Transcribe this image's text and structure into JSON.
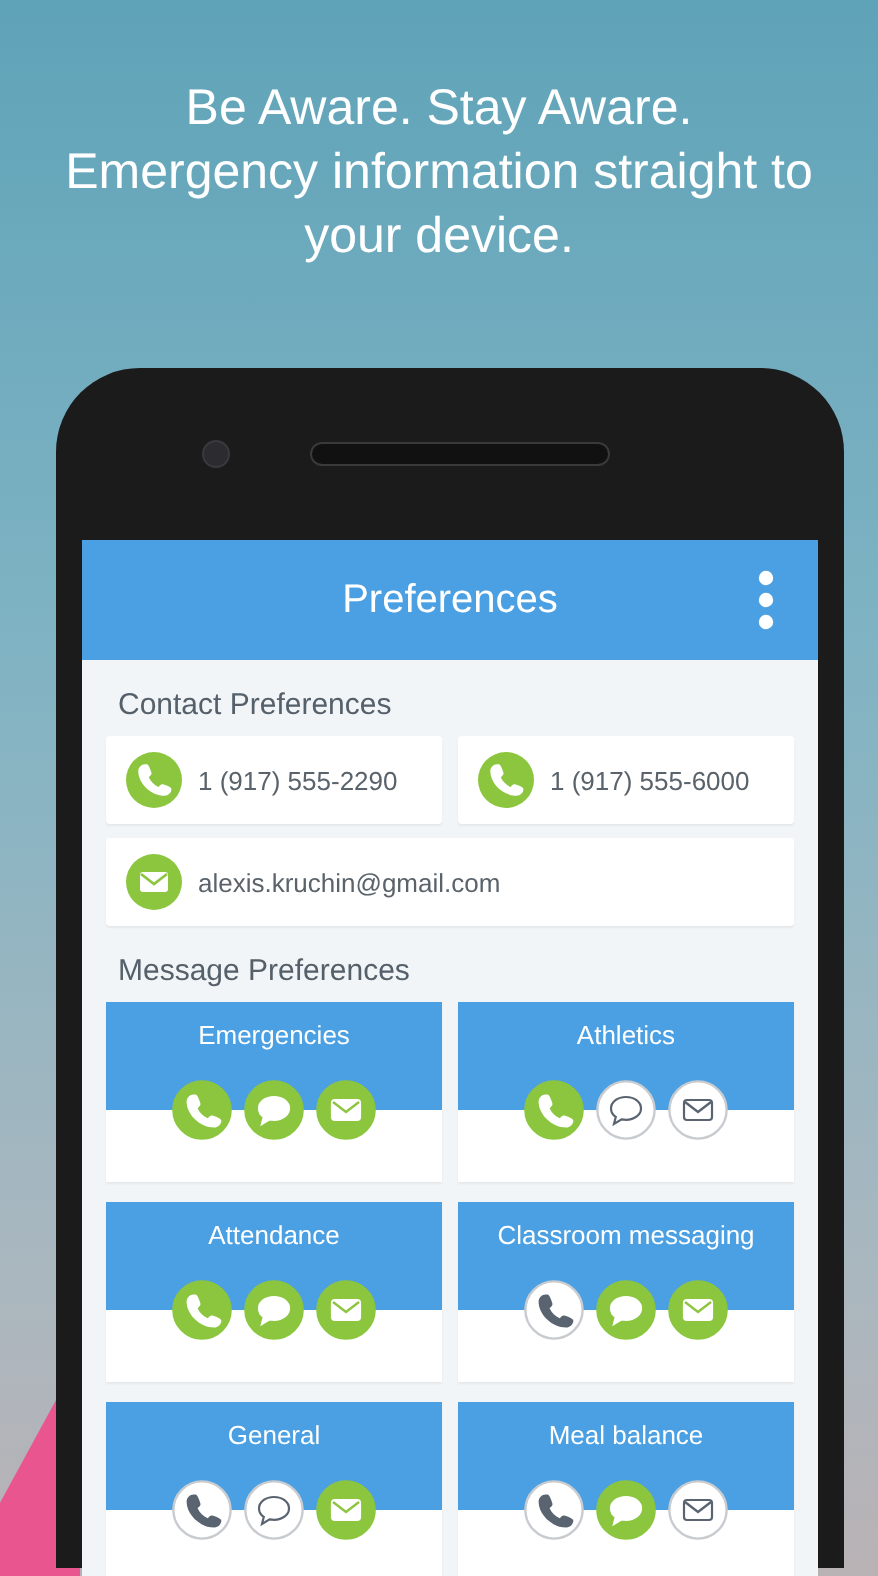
{
  "headline": [
    "Be Aware. Stay Aware.",
    "Emergency information straight to your device."
  ],
  "app_bar": {
    "title": "Preferences"
  },
  "contact_preferences": {
    "heading": "Contact Preferences",
    "contacts": [
      {
        "kind": "phone",
        "value": "1 (917) 555-2290"
      },
      {
        "kind": "phone",
        "value": "1 (917) 555-6000"
      },
      {
        "kind": "email",
        "value": "alexis.kruchin@gmail.com"
      }
    ]
  },
  "message_preferences": {
    "heading": "Message Preferences",
    "categories": [
      {
        "name": "Emergencies",
        "channels": [
          {
            "kind": "call",
            "on": true
          },
          {
            "kind": "sms",
            "on": true
          },
          {
            "kind": "email",
            "on": true
          }
        ]
      },
      {
        "name": "Athletics",
        "channels": [
          {
            "kind": "call",
            "on": true
          },
          {
            "kind": "sms",
            "on": false
          },
          {
            "kind": "email",
            "on": false
          }
        ]
      },
      {
        "name": "Attendance",
        "channels": [
          {
            "kind": "call",
            "on": true
          },
          {
            "kind": "sms",
            "on": true
          },
          {
            "kind": "email",
            "on": true
          }
        ]
      },
      {
        "name": "Classroom messaging",
        "channels": [
          {
            "kind": "call",
            "on": false
          },
          {
            "kind": "sms",
            "on": true
          },
          {
            "kind": "email",
            "on": true
          }
        ]
      },
      {
        "name": "General",
        "channels": [
          {
            "kind": "call",
            "on": false
          },
          {
            "kind": "sms",
            "on": false
          },
          {
            "kind": "email",
            "on": true
          }
        ]
      },
      {
        "name": "Meal balance",
        "channels": [
          {
            "kind": "call",
            "on": false
          },
          {
            "kind": "sms",
            "on": true
          },
          {
            "kind": "email",
            "on": false
          }
        ]
      }
    ]
  }
}
